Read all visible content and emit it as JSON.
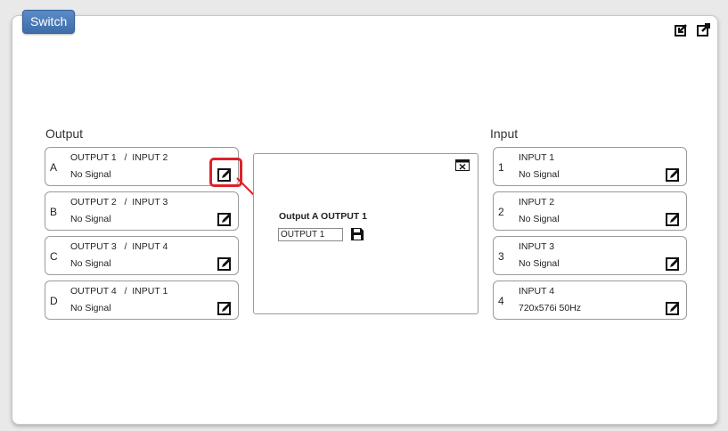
{
  "tab": {
    "label": "Switch"
  },
  "outputs": {
    "title": "Output",
    "rows": [
      {
        "letter": "A",
        "name": "OUTPUT 1",
        "route": "INPUT 2",
        "status": "No Signal"
      },
      {
        "letter": "B",
        "name": "OUTPUT 2",
        "route": "INPUT 3",
        "status": "No Signal"
      },
      {
        "letter": "C",
        "name": "OUTPUT 3",
        "route": "INPUT 4",
        "status": "No Signal"
      },
      {
        "letter": "D",
        "name": "OUTPUT 4",
        "route": "INPUT 1",
        "status": "No Signal"
      }
    ]
  },
  "inputs": {
    "title": "Input",
    "rows": [
      {
        "num": "1",
        "name": "INPUT 1",
        "status": "No Signal"
      },
      {
        "num": "2",
        "name": "INPUT 2",
        "status": "No Signal"
      },
      {
        "num": "3",
        "name": "INPUT 3",
        "status": "No Signal"
      },
      {
        "num": "4",
        "name": "INPUT 4",
        "status": "720x576i 50Hz"
      }
    ]
  },
  "editor": {
    "title": "Output A OUTPUT 1",
    "input_value": "OUTPUT 1"
  },
  "colors": {
    "accent": "#4a78b8",
    "highlight": "#e0202a"
  },
  "icons": [
    "export-icon",
    "popout-icon",
    "edit-icon",
    "close-icon",
    "save-icon"
  ]
}
